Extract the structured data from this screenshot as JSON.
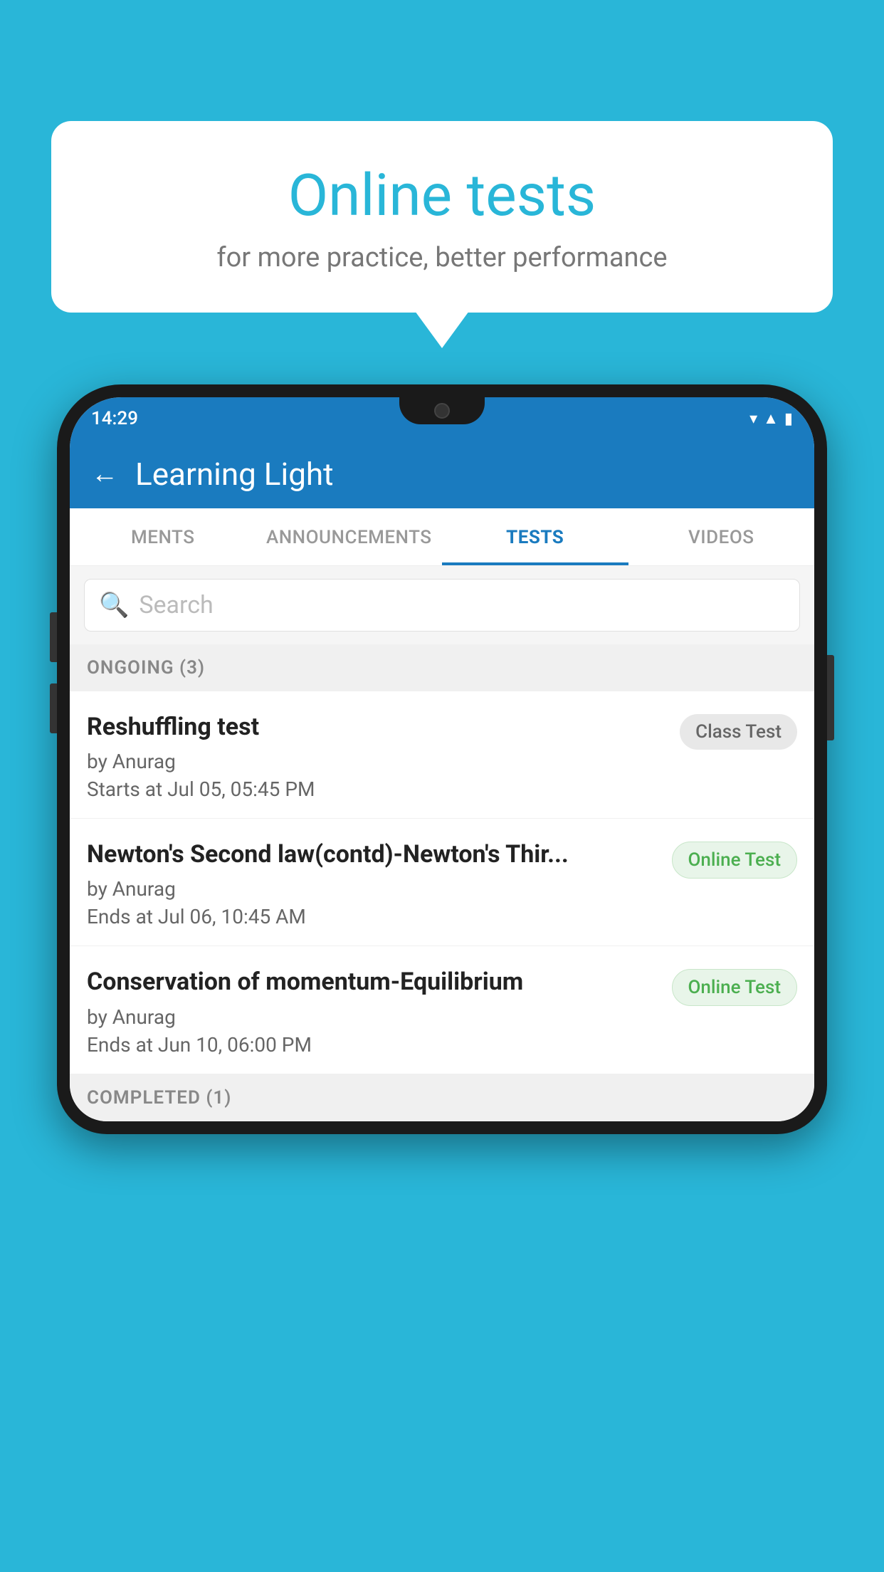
{
  "background_color": "#29b6d8",
  "bubble": {
    "title": "Online tests",
    "subtitle": "for more practice, better performance"
  },
  "phone": {
    "status_time": "14:29",
    "app_title": "Learning Light",
    "back_label": "←",
    "tabs": [
      {
        "label": "MENTS",
        "active": false
      },
      {
        "label": "ANNOUNCEMENTS",
        "active": false
      },
      {
        "label": "TESTS",
        "active": true
      },
      {
        "label": "VIDEOS",
        "active": false
      }
    ],
    "search_placeholder": "Search",
    "section_ongoing": "ONGOING (3)",
    "tests": [
      {
        "name": "Reshuffling test",
        "author": "by Anurag",
        "date": "Starts at  Jul 05, 05:45 PM",
        "badge": "Class Test",
        "badge_type": "class"
      },
      {
        "name": "Newton's Second law(contd)-Newton's Thir...",
        "author": "by Anurag",
        "date": "Ends at  Jul 06, 10:45 AM",
        "badge": "Online Test",
        "badge_type": "online"
      },
      {
        "name": "Conservation of momentum-Equilibrium",
        "author": "by Anurag",
        "date": "Ends at  Jun 10, 06:00 PM",
        "badge": "Online Test",
        "badge_type": "online"
      }
    ],
    "section_completed": "COMPLETED (1)"
  }
}
